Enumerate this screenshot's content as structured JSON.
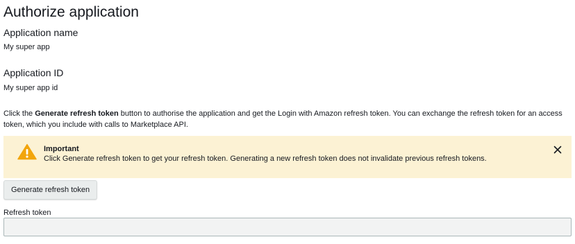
{
  "page": {
    "title": "Authorize application"
  },
  "application": {
    "name_label": "Application name",
    "name_value": "My super app",
    "id_label": "Application ID",
    "id_value": "My super app id"
  },
  "description": {
    "prefix": "Click the ",
    "button_ref": "Generate refresh token",
    "suffix": " button to authorise the application and get the Login with Amazon refresh token. You can exchange the refresh token for an access token, which you include with calls to Marketplace API."
  },
  "alert": {
    "title": "Important",
    "message": "Click Generate refresh token to get your refresh token. Generating a new refresh token does not invalidate previous refresh tokens.",
    "icon": "warning-icon",
    "close_icon": "close-icon"
  },
  "actions": {
    "generate_label": "Generate refresh token"
  },
  "refresh_token": {
    "label": "Refresh token",
    "value": ""
  },
  "colors": {
    "alert_background": "#fcf2d4",
    "warning_icon": "#f2a50c",
    "button_background": "#eaeded",
    "input_background": "#f2f3f3"
  }
}
